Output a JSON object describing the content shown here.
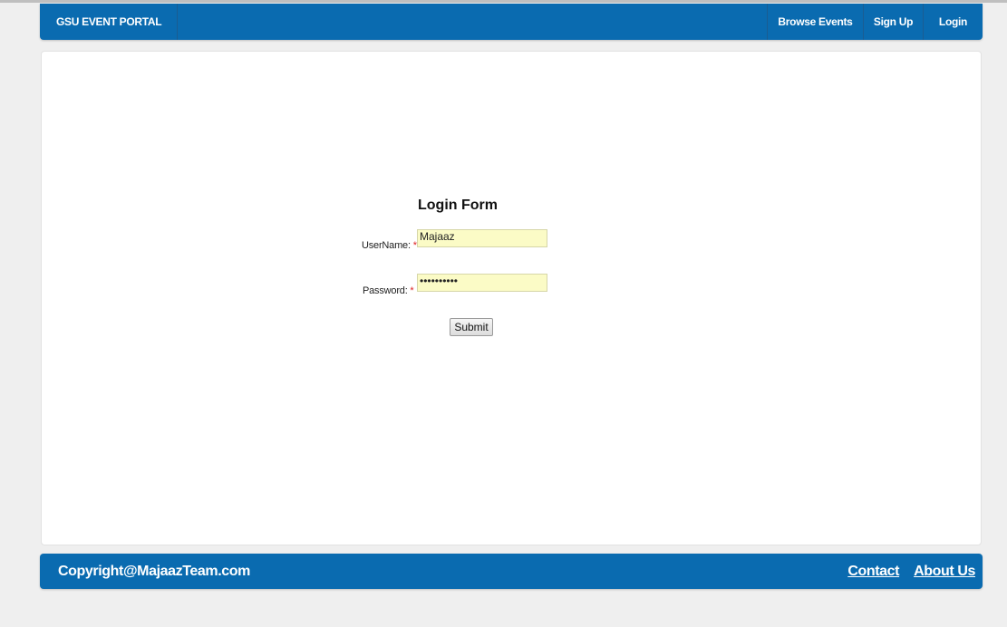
{
  "navbar": {
    "brand": "GSU EVENT PORTAL",
    "links": [
      {
        "label": "Browse Events"
      },
      {
        "label": "Sign Up"
      },
      {
        "label": "Login"
      }
    ]
  },
  "login_form": {
    "title": "Login Form",
    "username_label": "UserName:",
    "username_value": "Majaaz",
    "password_label": "Password:",
    "password_masked": "••••••••••",
    "required_marker": "*",
    "submit_label": "Submit"
  },
  "footer": {
    "copyright": "Copyright@MajaazTeam.com",
    "contact_label": "Contact",
    "about_label": "About Us"
  },
  "colors": {
    "nav_bar": "#0a6bb0",
    "input_background": "#fbfbc6",
    "required_marker": "#dd2222"
  }
}
